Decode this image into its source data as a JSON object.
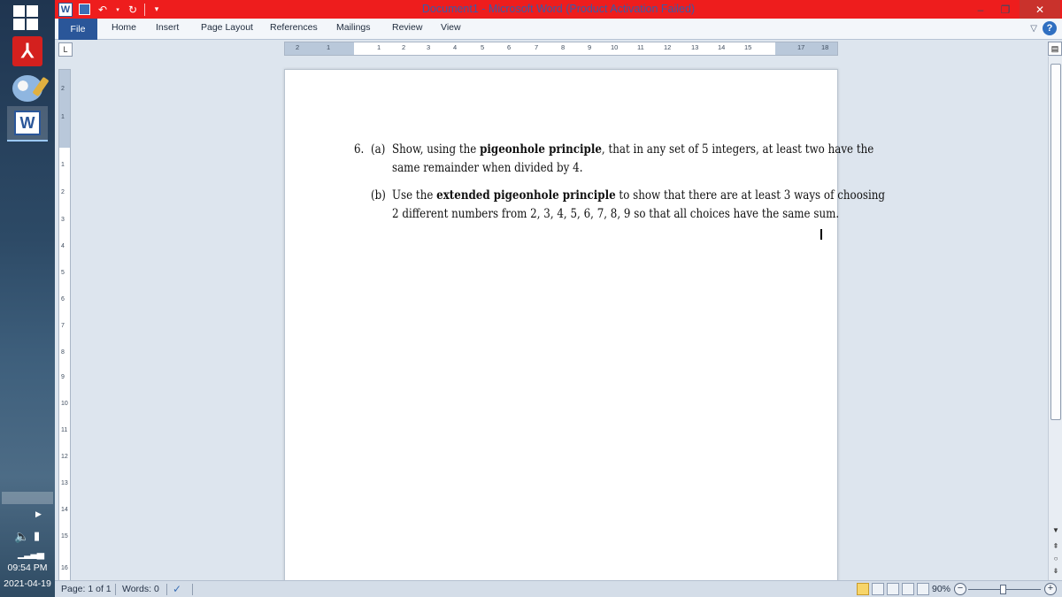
{
  "window": {
    "title": "Document1 - Microsoft Word (Product Activation Failed)",
    "title_bar_color": "#ee1d1d",
    "accent": "#2a5699"
  },
  "qat": {
    "app_icon": "W",
    "icons": [
      "word-icon",
      "save-icon",
      "undo-icon",
      "redo-icon",
      "customize-icon"
    ]
  },
  "window_controls": {
    "minimize": "–",
    "restore": "❐",
    "close": "✕"
  },
  "ribbon": {
    "tabs": [
      "File",
      "Home",
      "Insert",
      "Page Layout",
      "References",
      "Mailings",
      "Review",
      "View"
    ]
  },
  "ruler": {
    "tab_selector": "L",
    "h_numbers": [
      "2",
      "1",
      "1",
      "2",
      "3",
      "4",
      "5",
      "6",
      "7",
      "8",
      "9",
      "10",
      "11",
      "12",
      "13",
      "14",
      "15",
      "17",
      "18"
    ],
    "v_numbers": [
      "2",
      "1",
      "1",
      "2",
      "3",
      "4",
      "5",
      "6",
      "7",
      "8",
      "9",
      "10",
      "11",
      "12",
      "13",
      "14",
      "15",
      "16"
    ]
  },
  "document": {
    "problem_number": "6.",
    "part_a": {
      "label": "(a)",
      "line1_pre": "Show, using the ",
      "line1_bold": "pigeonhole principle",
      "line1_post": ", that in any set of 5 integers, at least two have the",
      "line2": "same remainder when divided by 4."
    },
    "part_b": {
      "label": "(b)",
      "line1_pre": "Use the ",
      "line1_bold": "extended pigeonhole principle",
      "line1_post": " to show that there are at least 3 ways of choosing",
      "line2": "2 different numbers from 2, 3, 4, 5, 6, 7, 8, 9 so that all choices have the same sum."
    }
  },
  "status": {
    "page": "Page: 1 of 1",
    "words": "Words: 0",
    "zoom": "90%",
    "zoom_level": 0.9
  },
  "taskbar": {
    "time": "09:54 PM",
    "date": "2021-04-19",
    "apps": [
      "acrobat-icon",
      "paint-icon",
      "word-icon"
    ]
  }
}
